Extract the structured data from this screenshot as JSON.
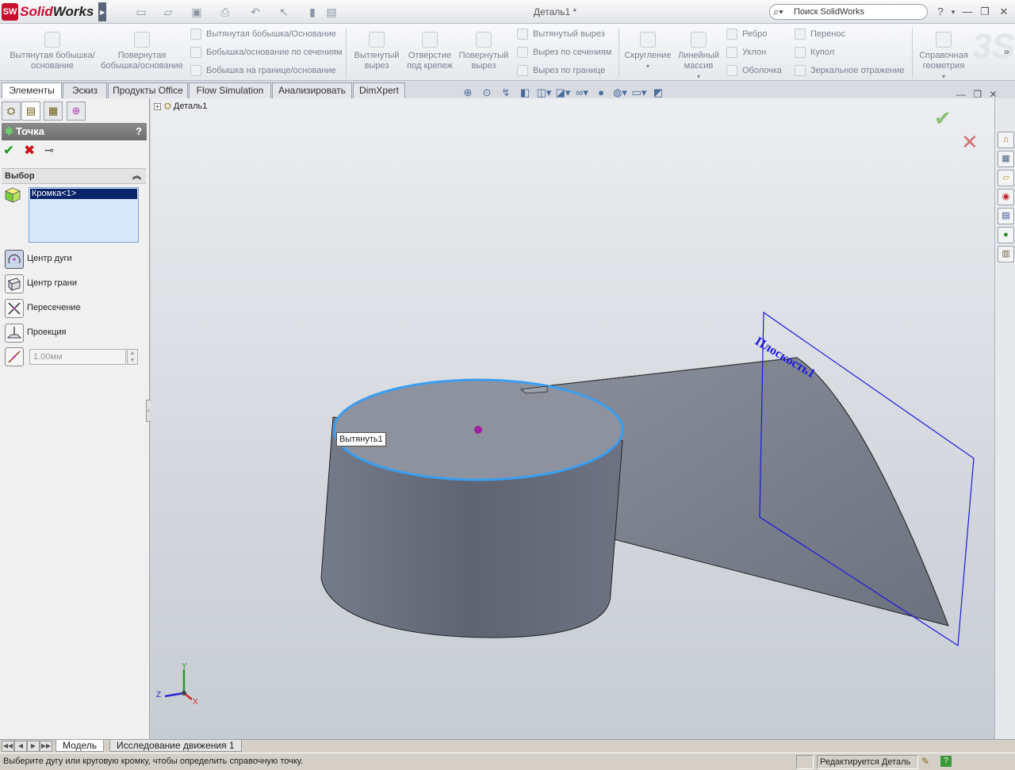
{
  "app": {
    "logo_sw": "SW",
    "logo_brand_solid": "Solid",
    "logo_brand_works": "Works",
    "doc_title": "Деталь1 *",
    "search_placeholder": "Поиск SolidWorks",
    "help": "?"
  },
  "toolbar": {
    "extrude_boss": "Вытянутая бобышка/основание",
    "revolve_boss": "Повернутая бобышка/основание",
    "sweep_boss": "Вытянутая бобышка/Основание",
    "loft_boss": "Бобышка/основание по сечениям",
    "boundary_boss": "Бобышка на границе/основание",
    "extrude_cut": "Вытянутый вырез",
    "hole_wizard": "Отверстие под крепеж",
    "revolve_cut": "Повернутый вырез",
    "sweep_cut": "Вытянутый вырез",
    "loft_cut": "Вырез по сечениям",
    "boundary_cut": "Вырез по границе",
    "fillet": "Скругление",
    "linear_pattern": "Линейный массив",
    "rib": "Ребро",
    "draft": "Уклон",
    "shell": "Оболочка",
    "wrap": "Перенос",
    "dome": "Купол",
    "mirror": "Зеркальное отражение",
    "ref_geometry": "Справочная геометрия"
  },
  "tabs": [
    "Элементы",
    "Эскиз",
    "Продукты Office",
    "Flow Simulation",
    "Анализировать",
    "DimXpert"
  ],
  "property_manager": {
    "title": "Точка",
    "help": "?",
    "selection_header": "Выбор",
    "selected_item": "Кромка<1>",
    "options": [
      "Центр дуги",
      "Центр грани",
      "Пересечение",
      "Проекция"
    ],
    "distance_value": "1.00мм"
  },
  "tree": {
    "root": "Деталь1"
  },
  "viewport": {
    "feature_label": "Вытянуть1",
    "plane_label": "Плоскость1",
    "axis_x": "X",
    "axis_y": "Y",
    "axis_z": "Z"
  },
  "bottom_tabs": [
    "Модель",
    "Исследование движения 1"
  ],
  "status": {
    "message": "Выберите дугу или круговую кромку, чтобы определить справочную точку.",
    "mode": "Редактируется Деталь"
  },
  "colors": {
    "accent_red": "#c8102e",
    "selection_blue": "#3a9ef0",
    "plane_blue": "#1a1ae0"
  }
}
